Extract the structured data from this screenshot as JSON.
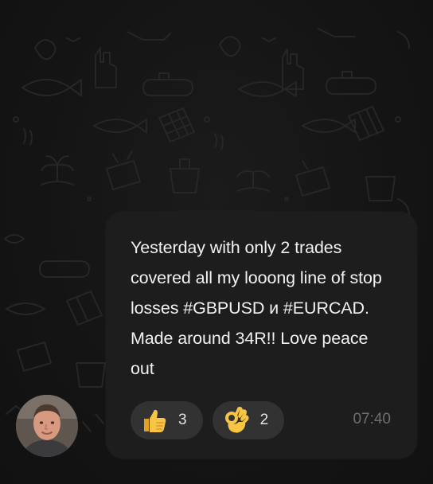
{
  "message": {
    "text": "Yesterday with only 2 trades\ncovered all my looong line of stop\nlosses #GBPUSD и #EURCAD.\nMade around 34R!! Love peace\nout",
    "time": "07:40",
    "reactions": [
      {
        "icon": "thumbs-up-icon",
        "count": "3"
      },
      {
        "icon": "ok-hand-icon",
        "count": "2"
      }
    ]
  },
  "colors": {
    "background": "#121212",
    "bubble": "#1d1d1d",
    "reaction_chip": "#323232",
    "text": "#f1f1f1",
    "timestamp": "#6f6f6f",
    "emoji": "#f7b731"
  }
}
